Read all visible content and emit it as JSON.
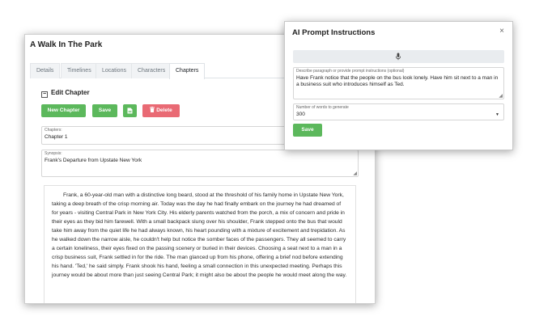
{
  "main": {
    "title": "A Walk In The Park",
    "tabs": [
      "Details",
      "Timelines",
      "Locations",
      "Characters",
      "Chapters"
    ],
    "section_title": "Edit Chapter",
    "buttons": {
      "new_chapter": "New Chapter",
      "save": "Save",
      "delete": "Delete"
    },
    "chapters_label": "Chapters:",
    "chapters_value": "Chapter 1",
    "synopsis_label": "Synopsis:",
    "synopsis_value": "Frank's Departure from Upstate New York",
    "story_text": "Frank, a 60-year-old man with a distinctive long beard, stood at the threshold of his family home in Upstate New York, taking a deep breath of the crisp morning air. Today was the day he had finally embark on the journey he had dreamed of for years - visiting Central Park in New York City. His elderly parents watched from the porch, a mix of concern and pride in their eyes as they bid him farewell. With a small backpack slung over his shoulder, Frank stepped onto the bus that would take him away from the quiet life he had always known, his heart pounding with a mixture of excitement and trepidation. As he walked down the narrow aisle, he couldn't help but notice the somber faces of the passengers. They all seemed to carry a certain loneliness, their eyes fixed on the passing scenery or buried in their devices. Choosing a seat next to a man in a crisp business suit, Frank settled in for the ride. The man glanced up from his phone, offering a brief nod before extending his hand. 'Ted,' he said simply. Frank shook his hand, feeling a small connection in this unexpected meeting. Perhaps this journey would be about more than just seeing Central Park; it might also be about the people he would meet along the way."
  },
  "ai": {
    "title": "AI Prompt Instructions",
    "close_glyph": "×",
    "prompt_label": "Describe paragraph or provide prompt instructions (optional)",
    "prompt_value": "Have Frank notice that the people on the bus look lonely. Have him sit next to a man in a business suit who introduces himself as Ted.",
    "words_label": "Number of words to generate",
    "words_value": "300",
    "save_label": "Save"
  },
  "colors": {
    "green": "#5cb85c",
    "red": "#e96a74"
  }
}
